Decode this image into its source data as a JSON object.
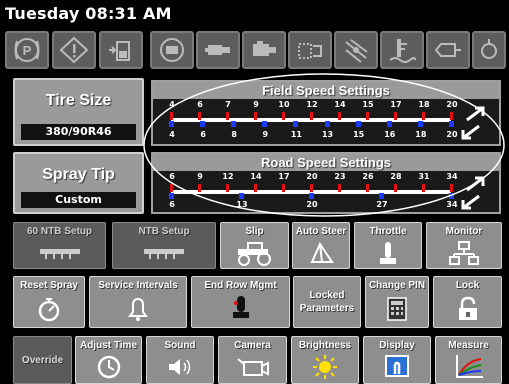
{
  "title": "Tuesday 08:31 AM",
  "icons": [
    "parking-brake-icon",
    "warning-icon",
    "tank-level-icon",
    "engine-icon",
    "hydraulic-icon",
    "transmission-icon",
    "filter-icon",
    "fan-icon",
    "fluid-level-icon",
    "pump-icon",
    "oil-icon"
  ],
  "tire_size": {
    "label": "Tire Size",
    "value": "380/90R46"
  },
  "spray_tip": {
    "label": "Spray Tip",
    "value": "Custom"
  },
  "field_speed": {
    "title": "Field Speed Settings",
    "top_ticks": [
      "4",
      "6",
      "7",
      "9",
      "10",
      "12",
      "14",
      "15",
      "17",
      "18",
      "20"
    ],
    "bottom_ticks": [
      "4",
      "6",
      "8",
      "9",
      "11",
      "13",
      "15",
      "16",
      "18",
      "20"
    ]
  },
  "road_speed": {
    "title": "Road Speed Settings",
    "top_ticks": [
      "6",
      "9",
      "12",
      "14",
      "17",
      "20",
      "23",
      "26",
      "28",
      "31",
      "34"
    ],
    "bottom_ticks": [
      "6",
      "13",
      "20",
      "27",
      "34"
    ]
  },
  "buttons": {
    "ntb60": "60 NTB Setup",
    "ntb": "NTB Setup",
    "slip": "Slip",
    "auto_steer": "Auto Steer",
    "throttle": "Throttle",
    "monitor": "Monitor",
    "reset_spray": "Reset Spray",
    "service_intervals": "Service Intervals",
    "end_row": "End Row Mgmt",
    "locked_parameters_1": "Locked",
    "locked_parameters_2": "Parameters",
    "change_pin": "Change PIN",
    "lock": "Lock",
    "override": "Override",
    "adjust_time": "Adjust Time",
    "sound": "Sound",
    "camera": "Camera",
    "brightness": "Brightness",
    "display": "Display",
    "measure": "Measure"
  },
  "colors": {
    "red_marker": "#e01010",
    "blue_marker": "#1a3cff",
    "yellow": "#ffe000"
  }
}
